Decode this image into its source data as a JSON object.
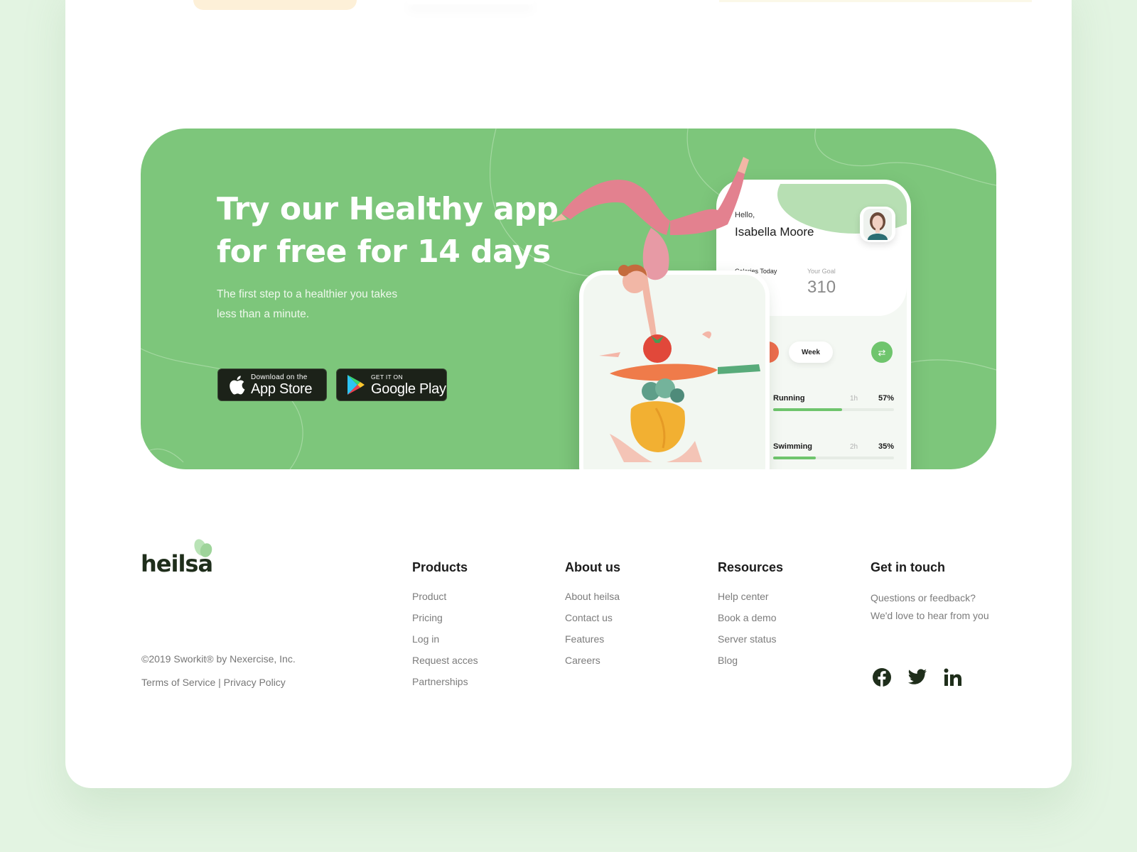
{
  "banner": {
    "headline_line1": "Try our Healthy app",
    "headline_line2": "for free for 14 days",
    "subtext_line1": "The first step to a healthier you takes",
    "subtext_line2": "less than a minute."
  },
  "store_buttons": {
    "apple_small": "Download on the",
    "apple_big": "App Store",
    "google_small": "GET IT ON",
    "google_big": "Google Play"
  },
  "phone": {
    "greeting": "Hello,",
    "user_name": "Isabella Moore",
    "calories_label": "Calories Today",
    "goal_label": "Your Goal",
    "goal_value": "310",
    "period": "Week",
    "activities": [
      {
        "name": "Running",
        "duration": "1h",
        "percent": "57%",
        "progress": 0.57
      },
      {
        "name": "Swimming",
        "duration": "2h",
        "percent": "35%",
        "progress": 0.35
      }
    ]
  },
  "footer": {
    "logo": "heilsa",
    "copyright": "©2019 Sworkit® by Nexercise, Inc.",
    "terms": "Terms of Service",
    "separator": "|",
    "privacy": "Privacy Policy",
    "columns": [
      {
        "title": "Products",
        "links": [
          "Product",
          "Pricing",
          "Log in",
          "Request acces",
          "Partnerships"
        ]
      },
      {
        "title": "About us",
        "links": [
          "About heilsa",
          "Contact us",
          "Features",
          "Careers"
        ]
      },
      {
        "title": "Resources",
        "links": [
          "Help center",
          "Book a demo",
          "Server status",
          "Blog"
        ]
      }
    ],
    "contact": {
      "title": "Get in touch",
      "line1": "Questions or feedback?",
      "line2": "We'd love to hear from you"
    },
    "social": [
      "facebook-icon",
      "twitter-icon",
      "linkedin-icon"
    ]
  },
  "colors": {
    "banner_green": "#7dc67b",
    "accent_green": "#6fc56d",
    "dark_text": "#1f2e1b",
    "page_background": "#e3f4e2"
  }
}
